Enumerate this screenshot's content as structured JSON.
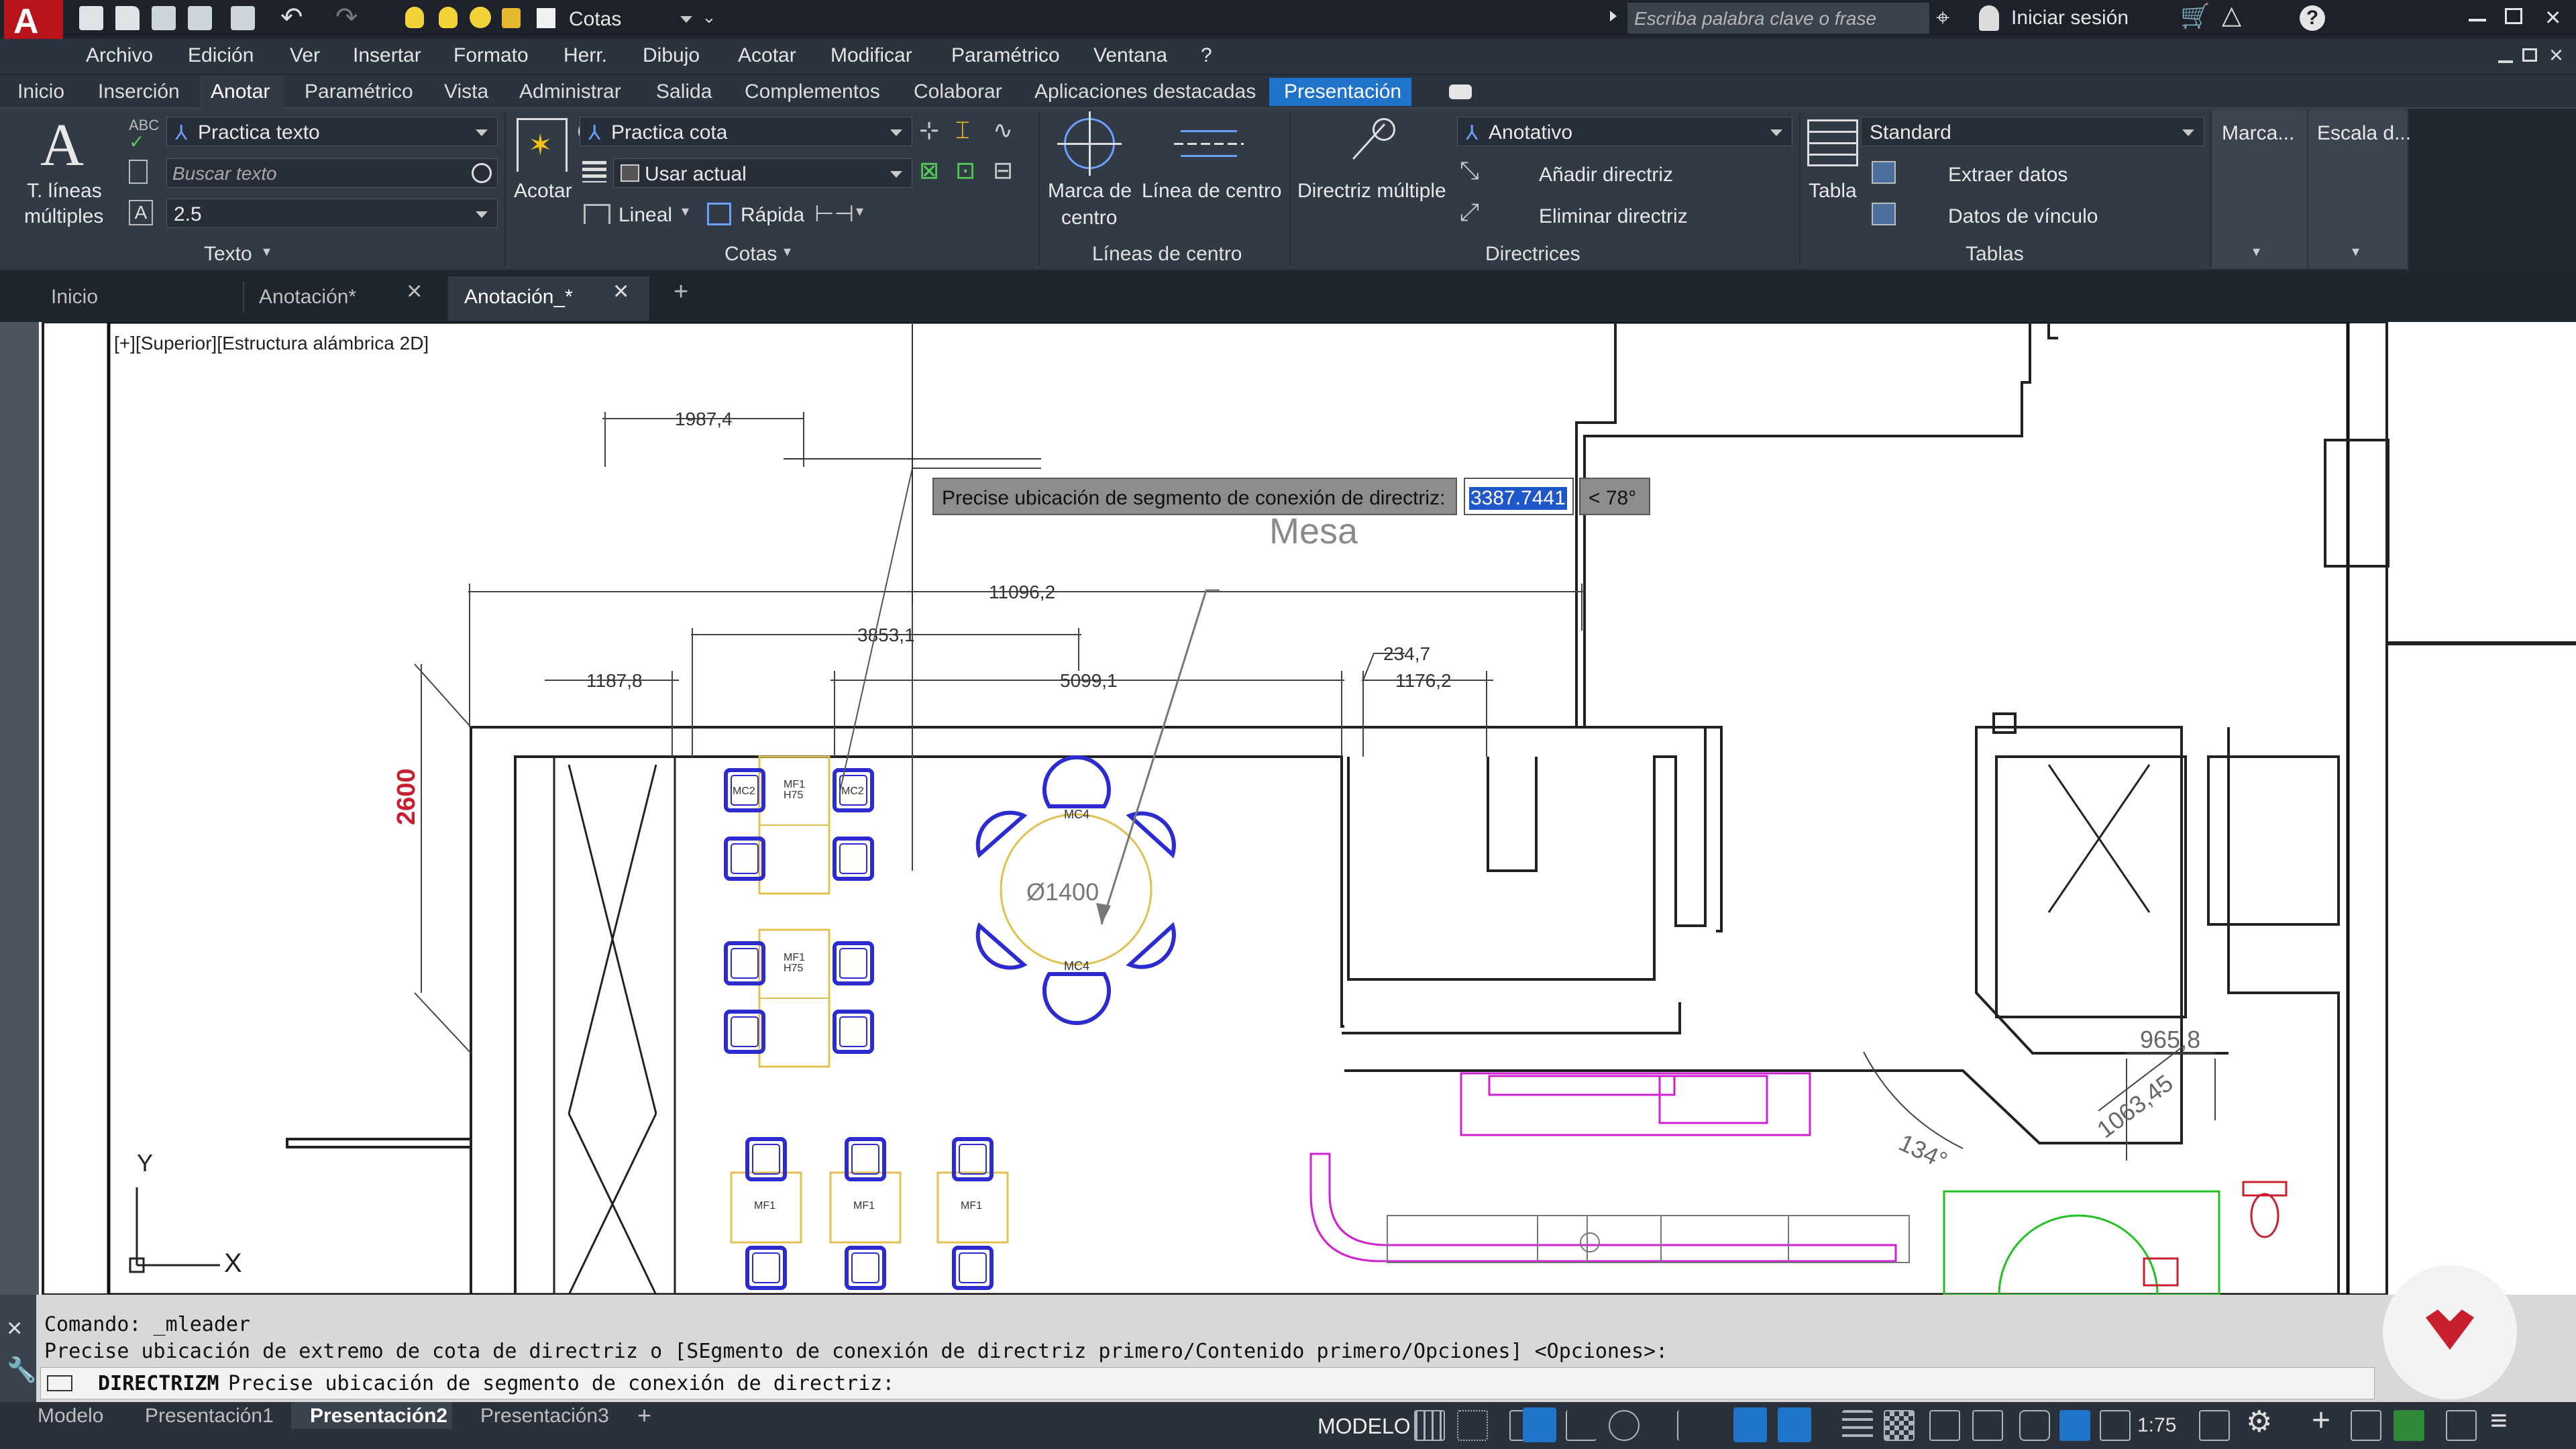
{
  "titlebar": {
    "workspace": "Cotas",
    "search_placeholder": "Escriba palabra clave o frase",
    "signin": "Iniciar sesión"
  },
  "menu": [
    "Archivo",
    "Edición",
    "Ver",
    "Insertar",
    "Formato",
    "Herr.",
    "Dibujo",
    "Acotar",
    "Modificar",
    "Paramétrico",
    "Ventana",
    "?"
  ],
  "ribbon_tabs": [
    "Inicio",
    "Inserción",
    "Anotar",
    "Paramétrico",
    "Vista",
    "Administrar",
    "Salida",
    "Complementos",
    "Colaborar",
    "Aplicaciones destacadas",
    "Presentación"
  ],
  "ribbon": {
    "text_panel": {
      "big_label_1": "T. líneas",
      "big_label_2": "múltiples",
      "style": "Practica texto",
      "search_placeholder": "Buscar texto",
      "height": "2.5",
      "title": "Texto"
    },
    "dim_panel": {
      "big_label": "Acotar",
      "style": "Practica cota",
      "layer": "Usar actual",
      "linear": "Lineal",
      "quick": "Rápida",
      "title": "Cotas"
    },
    "center_panel": {
      "mark_1": "Marca de",
      "mark_2": "centro",
      "centerline": "Línea de centro",
      "title": "Líneas de centro"
    },
    "leader_panel": {
      "multi": "Directriz múltiple",
      "style": "Anotativo",
      "add": "Añadir directriz",
      "remove": "Eliminar directriz",
      "title": "Directrices"
    },
    "tables_panel": {
      "table": "Tabla",
      "style": "Standard",
      "extract": "Extraer datos",
      "link": "Datos de vínculo",
      "title": "Tablas"
    },
    "extra": [
      "Marca...",
      "Escala d..."
    ]
  },
  "doc_tabs": [
    "Inicio",
    "Anotación*",
    "Anotación_*"
  ],
  "viewport_label": "[+][Superior][Estructura alámbrica 2D]",
  "drawing": {
    "dims": [
      "1987,4",
      "11096,2",
      "3853,1",
      "1187,8",
      "5099,1",
      "234,7",
      "1176,2",
      "2600",
      "965,8",
      "1063,45"
    ],
    "angle": "134°",
    "diameter": "Ø1400",
    "leader_text": "Mesa",
    "chair_round": "MC4",
    "chair_rect": "MC2",
    "table_label_1": "MF1",
    "table_label_2": "H75",
    "ucs_x": "X",
    "ucs_y": "Y"
  },
  "tooltip": {
    "prompt": "Precise ubicación de segmento de conexión de directriz:",
    "value": "3387.7441",
    "angle": "< 78°"
  },
  "command": {
    "line1": "Comando: _mleader",
    "line2": "Precise ubicación de extremo de cota de directriz o [SEgmento de conexión de directriz primero/Contenido primero/Opciones] <Opciones>:",
    "cmd_name": "DIRECTRIZM",
    "prompt": "Precise ubicación de segmento de conexión de directriz:"
  },
  "layout_tabs": [
    "Modelo",
    "Presentación1",
    "Presentación2",
    "Presentación3"
  ],
  "status": {
    "space": "MODELO",
    "scale": "1:75"
  },
  "colors": {
    "accent_blue": "#1f73c8",
    "app_red": "#c8102e",
    "chair_blue": "#2b2bd0",
    "table_yellow": "#e0c050",
    "magenta": "#d020d0",
    "green": "#20c020"
  }
}
